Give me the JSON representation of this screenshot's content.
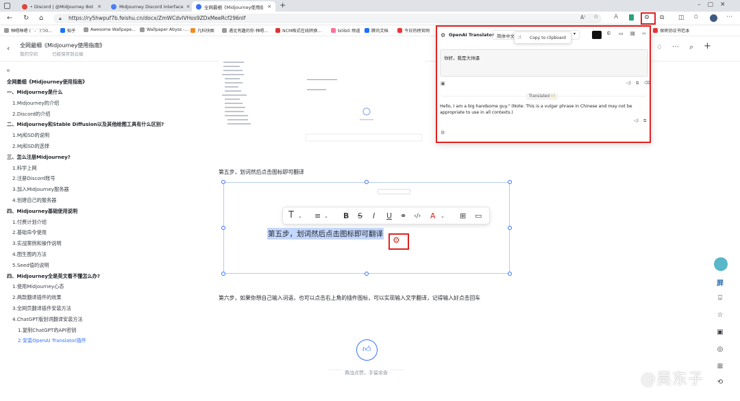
{
  "browser": {
    "tabs": [
      {
        "label": "• Discord | @Midjourney Bot",
        "active": false
      },
      {
        "label": "Midjourney Discord Interface",
        "active": false
      },
      {
        "label": "全网最细《Midjourney使用指南》",
        "active": true
      }
    ],
    "url": "https://ry5hwpuf7b.feishu.cn/docx/ZmWCdvlVHos9ZDxMeeRcf296nlf",
    "bookmarks": [
      "种嗯种嗯 ( ˙-˙ )つ0...",
      "知乎",
      "Awesome Wallpape...",
      "Wallpaper Abyss -...",
      "凡科快图",
      "遇见有趣的你·种嗯...",
      "NCM格式在线转换...",
      "bilibili 频道",
      "腾讯文档",
      "今日热榜官网",
      "保密协议书范本"
    ]
  },
  "doc_header": {
    "title": "全网最细《Midjourney使用指南》",
    "breadcrumb_space": "我的空间",
    "saved_status": "已经保存到云端"
  },
  "outline": {
    "doc_title": "全网最细《Midjourney使用指南》",
    "items": [
      {
        "level": 1,
        "text": "一、Midjourney是什么"
      },
      {
        "level": 2,
        "text": "1.Midjourney的介绍"
      },
      {
        "level": 2,
        "text": "2.Discord的介绍"
      },
      {
        "level": 1,
        "text": "二、Midjourney和Stable Diffusion以及其他绘图工具有什么区别?"
      },
      {
        "level": 2,
        "text": "1.MJ和SD的说明"
      },
      {
        "level": 2,
        "text": "2.MJ和SD的选择"
      },
      {
        "level": 1,
        "text": "三、怎么注册Midjourney?"
      },
      {
        "level": 2,
        "text": "1.科学上网"
      },
      {
        "level": 2,
        "text": "2.注册Discord账号"
      },
      {
        "level": 2,
        "text": "3.加入Midjourney服务器"
      },
      {
        "level": 2,
        "text": "4.创建自己的服务器"
      },
      {
        "level": 1,
        "text": "四、Midjourney基础使用说明"
      },
      {
        "level": 2,
        "text": "1.付费计划介绍"
      },
      {
        "level": 2,
        "text": "2.基础命令使用"
      },
      {
        "level": 2,
        "text": "3.实战案例和操作说明"
      },
      {
        "level": 2,
        "text": "4.图生图的方法"
      },
      {
        "level": 2,
        "text": "5.Seed值的说明"
      },
      {
        "level": 1,
        "text": "四、Midjourney全是英文看不懂怎么办?"
      },
      {
        "level": 2,
        "text": "1.使用Midjourney心态"
      },
      {
        "level": 2,
        "text": "2.两款翻译插件的效果"
      },
      {
        "level": 2,
        "text": "3.全网页翻译插件安装方法"
      },
      {
        "level": 2,
        "text": "4.ChatGPT版划词翻译安装方法"
      },
      {
        "level": 3,
        "text": "1.复制ChatGPT的API密钥"
      },
      {
        "level": 3,
        "text": "2.安装OpenAI Translator插件",
        "selected": true
      }
    ]
  },
  "content": {
    "step5": "第五步，划词然后点击图标即可翻译",
    "highlighted": "第五步，划词然后点击图标即可翻译",
    "step6": "第六步，如果你想自己输入词语，也可以点击右上角的插件图标，可以实现输入文字翻译，记得输入好点击回车",
    "like_caption": "赛战点赞，手留余香",
    "watermark": "@吴东子"
  },
  "translator": {
    "name": "OpenAI Translator",
    "source_lang": "简体中文",
    "tooltip": "Copy to clipboard",
    "input_text": "你好，我是大帅逼",
    "translated_label": "Translated",
    "output_text": "Hello, I am a big handsome guy.\" (Note: This is a vulgar phrase in Chinese and may not be appropriate to use in all contexts.)"
  },
  "colors": {
    "accent": "#3370ff",
    "highlight": "#e02020",
    "selection": "#c3d6fb"
  }
}
